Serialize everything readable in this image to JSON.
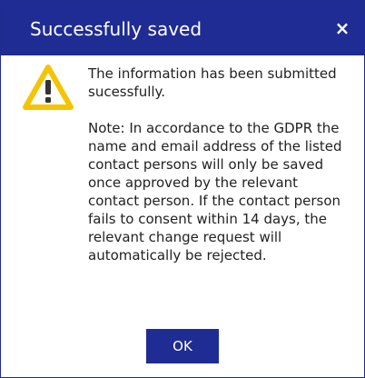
{
  "dialog": {
    "title": "Successfully saved",
    "close_label": "×",
    "message": "The information has been submitted sucessfully.",
    "note": "Note: In accordance to the GDPR the name and email address of the listed contact persons will only be saved once approved by the relevant contact person. If the contact person fails to consent within 14 days, the relevant change request will automatically be rejected.",
    "ok_label": "OK",
    "icon": "warning-icon"
  },
  "colors": {
    "accent": "#1f2c93",
    "warning": "#f5c400"
  }
}
